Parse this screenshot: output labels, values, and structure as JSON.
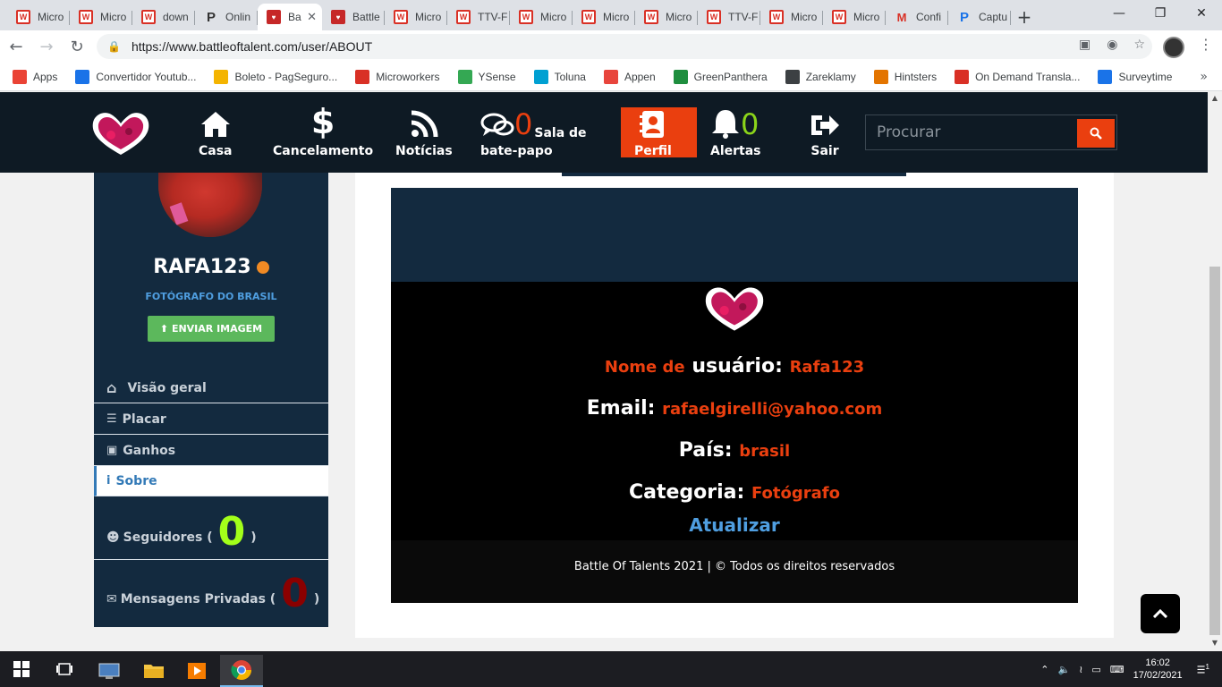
{
  "browser": {
    "tabs": [
      {
        "title": "Micro",
        "favicon": "W"
      },
      {
        "title": "Micro",
        "favicon": "W"
      },
      {
        "title": "down",
        "favicon": "W"
      },
      {
        "title": "Onlin",
        "favicon": "P"
      },
      {
        "title": "Ba",
        "favicon": "BT",
        "active": true
      },
      {
        "title": "Battle",
        "favicon": "BT"
      },
      {
        "title": "Micro",
        "favicon": "W"
      },
      {
        "title": "TTV-F",
        "favicon": "W"
      },
      {
        "title": "Micro",
        "favicon": "W"
      },
      {
        "title": "Micro",
        "favicon": "W"
      },
      {
        "title": "Micro",
        "favicon": "W"
      },
      {
        "title": "TTV-F",
        "favicon": "W"
      },
      {
        "title": "Micro",
        "favicon": "W"
      },
      {
        "title": "Micro",
        "favicon": "W"
      },
      {
        "title": "Confi",
        "favicon": "M"
      },
      {
        "title": "Captu",
        "favicon": "PB"
      }
    ],
    "url": "https://www.battleoftalent.com/user/ABOUT",
    "bookmarks": [
      {
        "label": "Apps",
        "icon": "apps-grid-icon",
        "color": "#ea4335"
      },
      {
        "label": "Convertidor Youtub...",
        "icon": "youtube-icon",
        "color": "#1a73e8"
      },
      {
        "label": "Boleto - PagSeguro...",
        "icon": "pagseguro-icon",
        "color": "#f4b400"
      },
      {
        "label": "Microworkers",
        "icon": "microworkers-icon",
        "color": "#d93025"
      },
      {
        "label": "YSense",
        "icon": "ysense-icon",
        "color": "#34a853"
      },
      {
        "label": "Toluna",
        "icon": "toluna-icon",
        "color": "#00a0d2"
      },
      {
        "label": "Appen",
        "icon": "appen-icon",
        "color": "#e8453c"
      },
      {
        "label": "GreenPanthera",
        "icon": "greenpanthera-icon",
        "color": "#1e8e3e"
      },
      {
        "label": "Zareklamy",
        "icon": "zareklamy-icon",
        "color": "#3c4043"
      },
      {
        "label": "Hintsters",
        "icon": "hintsters-icon",
        "color": "#e37400"
      },
      {
        "label": "On Demand Transla...",
        "icon": "translation-icon",
        "color": "#d93025"
      },
      {
        "label": "Surveytime",
        "icon": "surveytime-icon",
        "color": "#1a73e8"
      }
    ]
  },
  "nav": {
    "home": "Casa",
    "cancel": "Cancelamento",
    "news": "Notícias",
    "chat_count": "0",
    "chat_line1": "Sala de",
    "chat_line2": "bate-papo",
    "profile": "Perfil",
    "alerts_count": "0",
    "alerts": "Alertas",
    "logout": "Sair",
    "search_placeholder": "Procurar"
  },
  "sidebar": {
    "username": "RAFA123",
    "title": "FOTÓGRAFO DO BRASIL",
    "upload_button": "ENVIAR IMAGEM",
    "menu": [
      {
        "label": "Visão geral",
        "icon": "home-icon"
      },
      {
        "label": "Placar",
        "icon": "list-icon"
      },
      {
        "label": "Ganhos",
        "icon": "money-icon"
      },
      {
        "label": "Sobre",
        "icon": "info-icon",
        "active": true
      }
    ],
    "followers_label": "Seguidores (",
    "followers_count": "0",
    "messages_label": "Mensagens Privadas (",
    "messages_count": "0",
    "close_paren": ")"
  },
  "about": {
    "username_label_prefix": "Nome de",
    "username_label": "usuário:",
    "username_value": "Rafa123",
    "email_label": "Email:",
    "email_value": "rafaelgirelli@yahoo.com",
    "country_label": "País:",
    "country_value": "brasil",
    "category_label": "Categoria:",
    "category_value": "Fotógrafo",
    "update_link": "Atualizar",
    "footer": "Battle Of Talents 2021 | © Todos os direitos reservados"
  },
  "taskbar": {
    "time": "16:02",
    "date": "17/02/2021",
    "notification_count": "1"
  },
  "colors": {
    "accent": "#ea3f0f",
    "nav_bg": "#0e1a24",
    "sidebar_bg": "#132a3f",
    "link_blue": "#4f9ee0",
    "upload_green": "#5cb85c"
  }
}
